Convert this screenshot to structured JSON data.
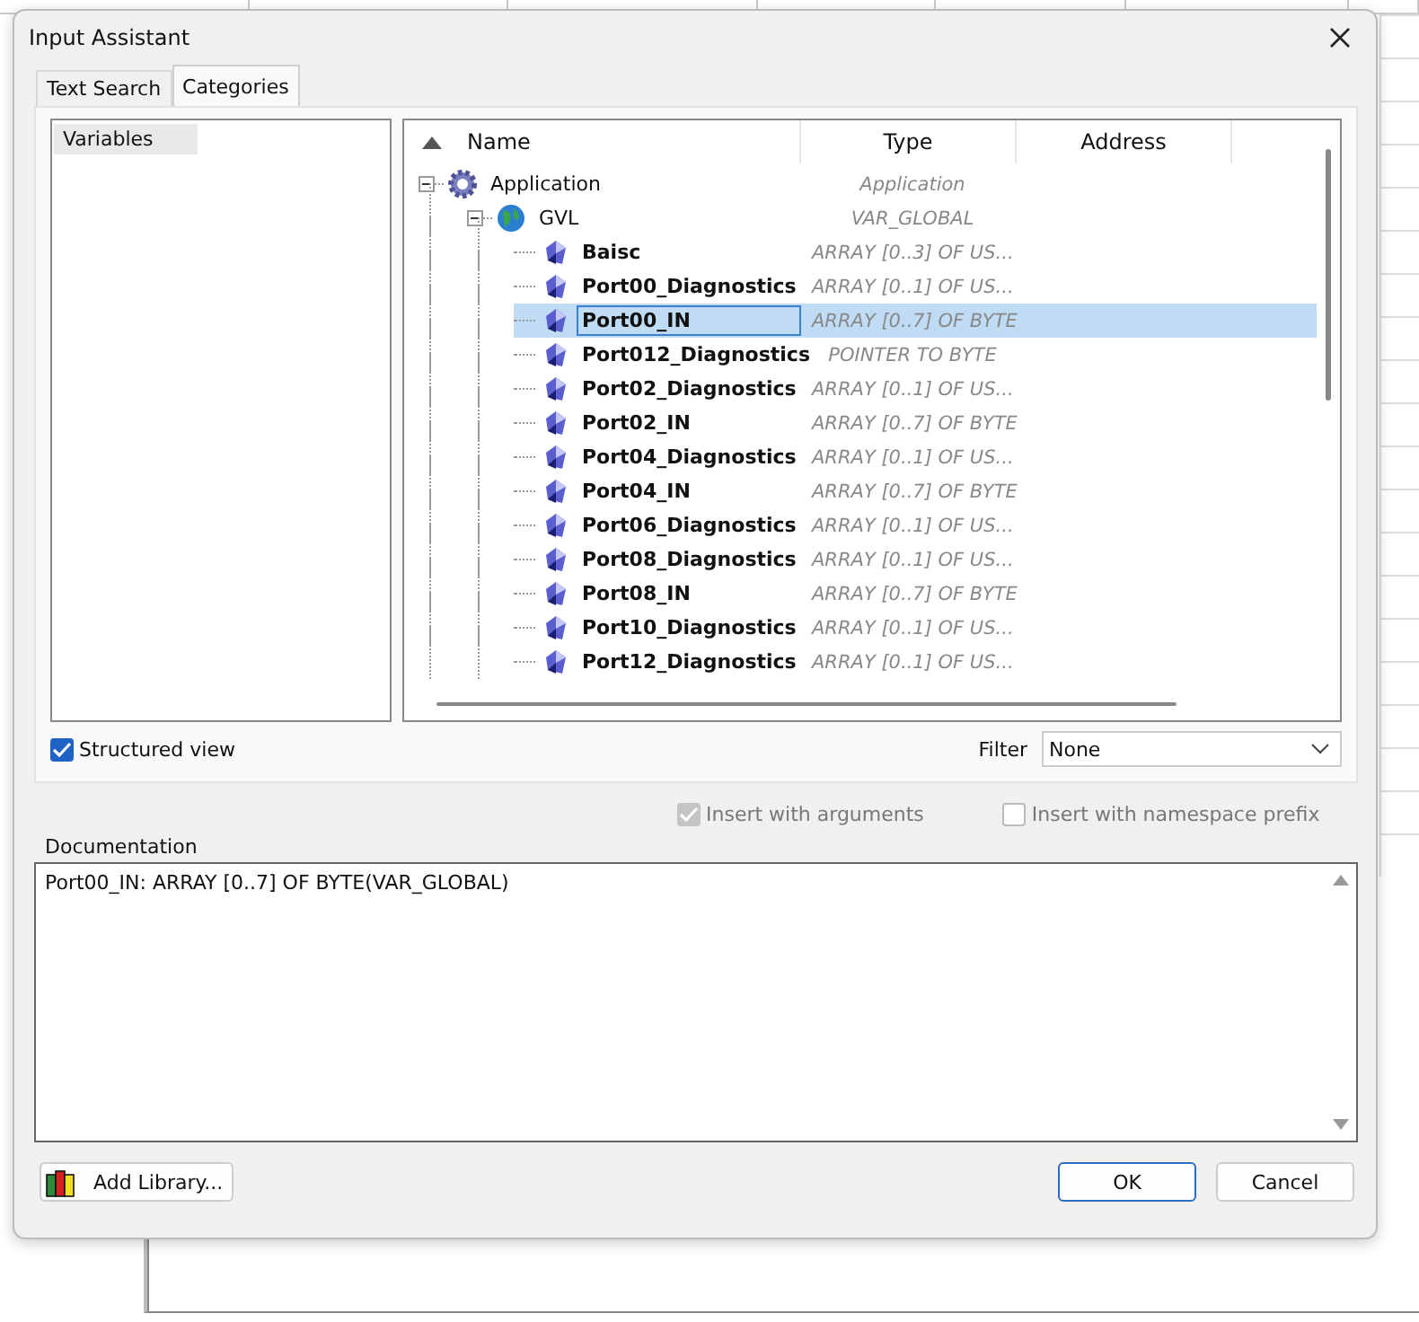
{
  "window": {
    "title": "Input Assistant"
  },
  "tabs": [
    {
      "label": "Text Search",
      "selected": false
    },
    {
      "label": "Categories",
      "selected": true
    }
  ],
  "categories": [
    {
      "label": "Variables",
      "selected": true
    }
  ],
  "tree": {
    "columns": [
      "Name",
      "Type",
      "Address"
    ],
    "rows": [
      {
        "kind": "application",
        "name": "Application",
        "type": "Application",
        "expanded": true,
        "selected": false,
        "children": [
          {
            "kind": "gvl",
            "name": "GVL",
            "type": "VAR_GLOBAL",
            "expanded": true,
            "selected": false,
            "children": [
              {
                "kind": "variable",
                "name": "Baisc",
                "type": "ARRAY [0..3] OF US...",
                "selected": false
              },
              {
                "kind": "variable",
                "name": "Port00_Diagnostics",
                "type": "ARRAY [0..1] OF US...",
                "selected": false
              },
              {
                "kind": "variable",
                "name": "Port00_IN",
                "type": "ARRAY [0..7] OF BYTE",
                "selected": true
              },
              {
                "kind": "variable",
                "name": "Port012_Diagnostics",
                "type": "POINTER TO BYTE",
                "selected": false
              },
              {
                "kind": "variable",
                "name": "Port02_Diagnostics",
                "type": "ARRAY [0..1] OF US...",
                "selected": false
              },
              {
                "kind": "variable",
                "name": "Port02_IN",
                "type": "ARRAY [0..7] OF BYTE",
                "selected": false
              },
              {
                "kind": "variable",
                "name": "Port04_Diagnostics",
                "type": "ARRAY [0..1] OF US...",
                "selected": false
              },
              {
                "kind": "variable",
                "name": "Port04_IN",
                "type": "ARRAY [0..7] OF BYTE",
                "selected": false
              },
              {
                "kind": "variable",
                "name": "Port06_Diagnostics",
                "type": "ARRAY [0..1] OF US...",
                "selected": false
              },
              {
                "kind": "variable",
                "name": "Port08_Diagnostics",
                "type": "ARRAY [0..1] OF US...",
                "selected": false
              },
              {
                "kind": "variable",
                "name": "Port08_IN",
                "type": "ARRAY [0..7] OF BYTE",
                "selected": false
              },
              {
                "kind": "variable",
                "name": "Port10_Diagnostics",
                "type": "ARRAY [0..1] OF US...",
                "selected": false
              },
              {
                "kind": "variable",
                "name": "Port12_Diagnostics",
                "type": "ARRAY [0..1] OF US...",
                "selected": false
              }
            ]
          }
        ]
      }
    ]
  },
  "structured_view": {
    "label": "Structured view",
    "checked": true
  },
  "filter": {
    "label": "Filter",
    "value": "None"
  },
  "options": [
    {
      "label": "Insert with arguments",
      "checked": true,
      "disabled": true
    },
    {
      "label": "Insert with namespace prefix",
      "checked": false,
      "disabled": true
    }
  ],
  "documentation": {
    "label": "Documentation",
    "text": "Port00_IN: ARRAY [0..7] OF BYTE(VAR_GLOBAL)"
  },
  "buttons": {
    "add_library": "Add Library...",
    "ok": "OK",
    "cancel": "Cancel"
  }
}
